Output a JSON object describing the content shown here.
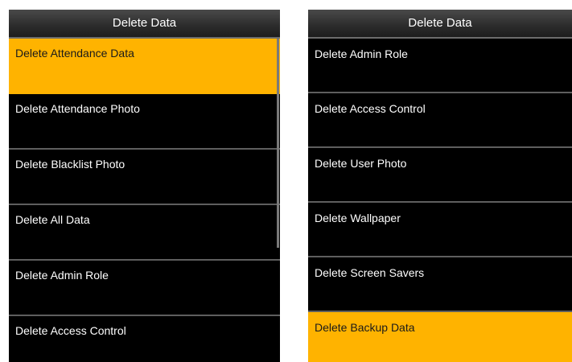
{
  "left_screen": {
    "title": "Delete Data",
    "items": [
      {
        "label": "Delete Attendance Data"
      },
      {
        "label": "Delete Attendance Photo"
      },
      {
        "label": "Delete Blacklist Photo"
      },
      {
        "label": "Delete All Data"
      },
      {
        "label": "Delete Admin Role"
      },
      {
        "label": "Delete Access Control"
      }
    ],
    "selected_item": "Delete Attendance Data"
  },
  "right_screen": {
    "title": "Delete Data",
    "items": [
      {
        "label": "Delete Admin Role"
      },
      {
        "label": "Delete Access Control"
      },
      {
        "label": "Delete User Photo"
      },
      {
        "label": "Delete Wallpaper"
      },
      {
        "label": "Delete Screen Savers"
      },
      {
        "label": "Delete Backup Data"
      }
    ],
    "selected_item": "Delete Backup Data"
  },
  "colors": {
    "highlight": "#ffb300",
    "background": "#000000",
    "separator": "#5e5e5e"
  }
}
